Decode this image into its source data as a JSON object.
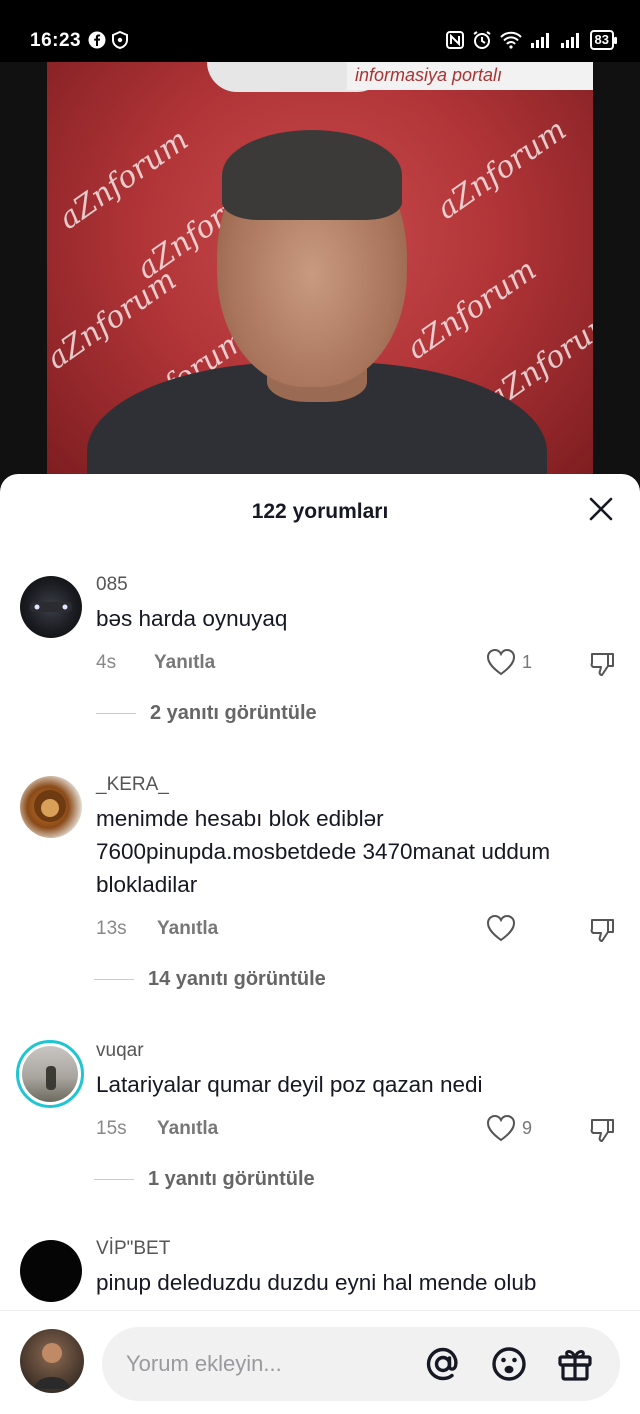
{
  "status_bar": {
    "time": "16:23",
    "battery": "83"
  },
  "video": {
    "banner_text": "informasiya portalı",
    "watermark": "aZnforum"
  },
  "comments_panel": {
    "title": "122 yorumları",
    "close_icon": "close-icon"
  },
  "comments": [
    {
      "username": "085",
      "text": "bəs harda oynuyaq",
      "time": "4s",
      "reply_label": "Yanıtla",
      "likes": "1",
      "view_replies": "2 yanıtı görüntüle"
    },
    {
      "username": "_KERA_",
      "text": "menimde hesabı blok ediblər 7600pinupda.mosbetdede 3470manat uddum blokladilar",
      "time": "13s",
      "reply_label": "Yanıtla",
      "likes": "",
      "view_replies": "14 yanıtı görüntüle"
    },
    {
      "username": "vuqar",
      "text": "Latariyalar qumar deyil poz qazan nedi",
      "time": "15s",
      "reply_label": "Yanıtla",
      "likes": "9",
      "view_replies": "1 yanıtı görüntüle"
    },
    {
      "username": "VİP\"BET",
      "text": "pinup deleduzdu duzdu eyni hal mende olub"
    }
  ],
  "input_bar": {
    "placeholder": "Yorum ekleyin...",
    "icons": [
      "at-icon",
      "emoji-icon",
      "gift-icon"
    ]
  },
  "colors": {
    "accent_ring": "#20c5d3",
    "text_primary": "#161823",
    "text_secondary": "#888888"
  }
}
